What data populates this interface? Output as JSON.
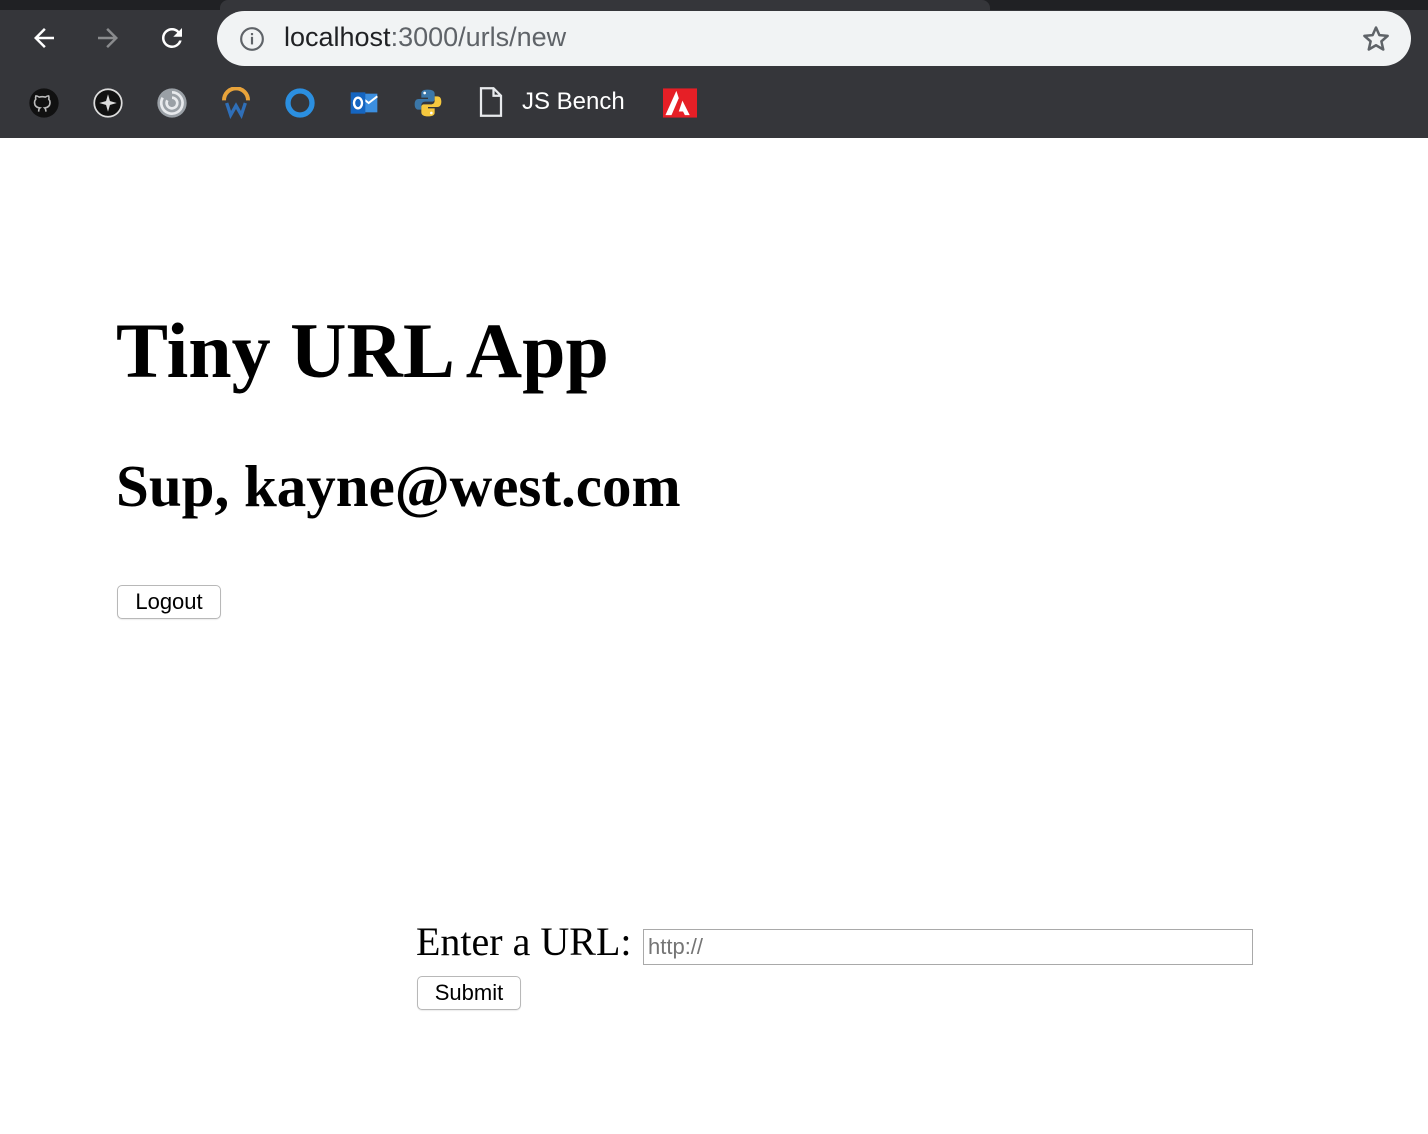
{
  "browser": {
    "url_host": "localhost",
    "url_path": ":3000/urls/new",
    "bookmarks": [
      {
        "name": "github-icon"
      },
      {
        "name": "compass-icon"
      },
      {
        "name": "spiral-icon"
      },
      {
        "name": "wordpress-icon"
      },
      {
        "name": "circle-icon"
      },
      {
        "name": "outlook-icon"
      },
      {
        "name": "python-icon"
      }
    ],
    "bookmark_js_bench": "JS Bench",
    "bookmark_adobe": "adobe-icon"
  },
  "page": {
    "title": "Tiny URL App",
    "greeting": "Sup, kayne@west.com",
    "logout_label": "Logout",
    "url_label": "Enter a URL:",
    "url_placeholder": "http://",
    "url_value": "",
    "submit_label": "Submit"
  },
  "colors": {
    "chrome_bg": "#35363a",
    "omnibox_bg": "#f1f3f4",
    "page_bg": "#ffffff"
  }
}
